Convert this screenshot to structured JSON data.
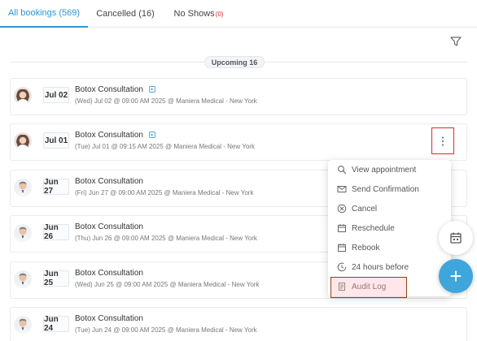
{
  "tabs": {
    "all_label": "All bookings (569)",
    "cancelled_label": "Cancelled (16)",
    "noshow_label": "No Shows",
    "noshow_count": "(0)"
  },
  "section": {
    "upcoming_label": "Upcoming 16"
  },
  "bookings": [
    {
      "date": "Jul 02",
      "title": "Botox Consultation",
      "details": "(Wed) Jul 02 @ 09:00 AM 2025 @ Maniera Medical - New York",
      "avatar": "female"
    },
    {
      "date": "Jul 01",
      "title": "Botox Consultation",
      "details": "(Tue) Jul 01 @ 09:15 AM 2025 @ Maniera Medical - New York",
      "avatar": "female"
    },
    {
      "date": "Jun 27",
      "title": "Botox Consultation",
      "details": "(Fri) Jun 27 @ 09:00 AM 2025 @ Maniera Medical - New York",
      "avatar": "male"
    },
    {
      "date": "Jun 26",
      "title": "Botox Consultation",
      "details": "(Thu) Jun 26 @ 09:00 AM 2025 @ Maniera Medical - New York",
      "avatar": "male"
    },
    {
      "date": "Jun 25",
      "title": "Botox Consultation",
      "details": "(Wed) Jun 25 @ 09:00 AM 2025 @ Maniera Medical - New York",
      "avatar": "male"
    },
    {
      "date": "Jun 24",
      "title": "Botox Consultation",
      "details": "(Tue) Jun 24 @ 09:00 AM 2025 @ Maniera Medical - New York",
      "avatar": "male"
    }
  ],
  "menu": {
    "items": [
      {
        "label": "View appointment",
        "icon": "search-icon"
      },
      {
        "label": "Send Confirmation",
        "icon": "mail-icon"
      },
      {
        "label": "Cancel",
        "icon": "cancel-icon"
      },
      {
        "label": "Reschedule",
        "icon": "calendar-icon"
      },
      {
        "label": "Rebook",
        "icon": "calendar-icon"
      },
      {
        "label": "24 hours before",
        "icon": "clock-icon"
      },
      {
        "label": "Audit Log",
        "icon": "document-icon"
      }
    ]
  },
  "fab": {
    "add_symbol": "+"
  },
  "colors": {
    "accent": "#2b97d4",
    "highlight_red": "#d32f2f",
    "fab_blue": "#3ea6db"
  }
}
